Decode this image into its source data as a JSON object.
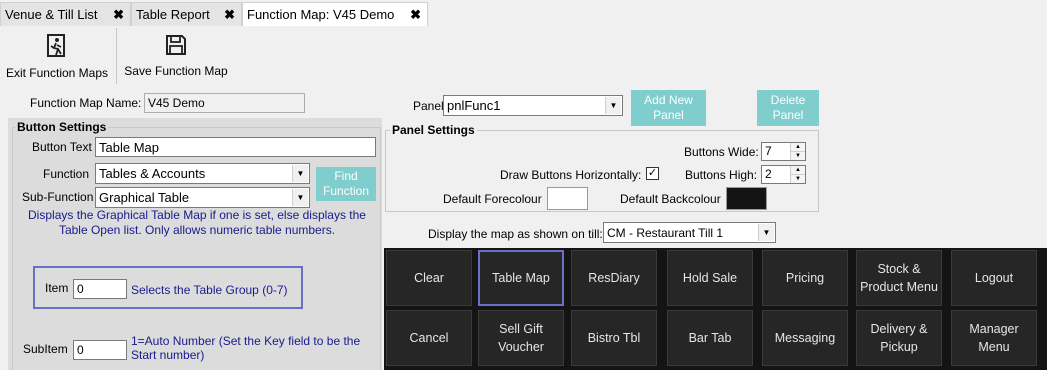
{
  "tabs": [
    {
      "label": "Venue & Till List"
    },
    {
      "label": "Table Report"
    },
    {
      "label": "Function Map: V45 Demo"
    }
  ],
  "tab_close_glyph": "✖",
  "toolbar": {
    "exit_label": "Exit Function Maps",
    "save_label": "Save Function Map",
    "exit_icon": "exit-door-icon",
    "save_icon": "floppy-disk-icon"
  },
  "function_map_name": {
    "label": "Function Map Name:",
    "value": "V45 Demo"
  },
  "button_settings": {
    "title": "Button Settings",
    "button_text_label": "Button Text",
    "button_text_value": "Table Map",
    "function_label": "Function",
    "function_value": "Tables & Accounts",
    "subfunction_label": "Sub-Function",
    "subfunction_value": "Graphical Table",
    "find_function": "Find Function",
    "description": "Displays the Graphical Table Map if one is set, else displays the Table Open list. Only allows numeric table numbers.",
    "item_label": "Item",
    "item_value": "0",
    "item_hint": "Selects the Table Group (0-7)",
    "subitem_label": "SubItem",
    "subitem_value": "0",
    "subitem_hint": "1=Auto Number (Set the Key field to be the Start number)"
  },
  "panel": {
    "label": "Panel",
    "value": "pnlFunc1",
    "add_button": "Add New Panel",
    "delete_button": "Delete Panel"
  },
  "panel_settings": {
    "title": "Panel Settings",
    "buttons_wide_label": "Buttons Wide:",
    "buttons_wide_value": "7",
    "draw_horizontal_label": "Draw Buttons Horizontally:",
    "draw_horizontal_checked": true,
    "check_glyph": "✓",
    "buttons_high_label": "Buttons High:",
    "buttons_high_value": "2",
    "forecolour_label": "Default Forecolour",
    "forecolour": "#ffffff",
    "backcolour_label": "Default Backcolour",
    "backcolour": "#141414"
  },
  "till": {
    "label": "Display the map as shown on till:",
    "value": "CM - Restaurant Till 1"
  },
  "function_buttons": [
    "Clear",
    "Table Map",
    "ResDiary",
    "Hold Sale",
    "Pricing",
    "Stock & Product Menu",
    "Logout",
    "Cancel",
    "Sell Gift Voucher",
    "Bistro Tbl",
    "Bar Tab",
    "Messaging",
    "Delivery & Pickup",
    "Manager Menu"
  ],
  "selected_button": "Table Map",
  "colors": {
    "teal": "#7fcdcd",
    "selection": "#6a70c8",
    "hint_text": "#1a1a8e"
  }
}
